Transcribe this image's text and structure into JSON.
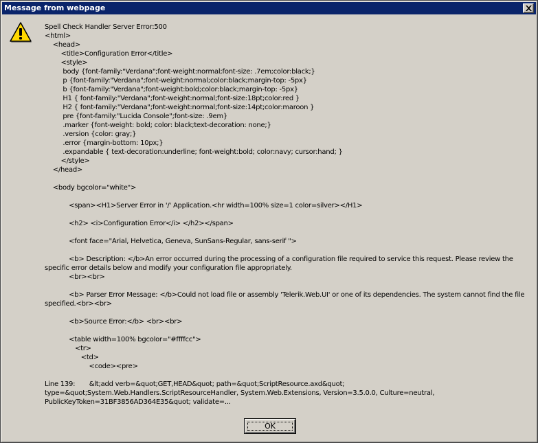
{
  "dialog": {
    "title": "Message from webpage",
    "icon": "warning-icon",
    "message": "Spell Check Handler Server Error:500\n<html>\n    <head>\n        <title>Configuration Error</title>\n        <style>\n         body {font-family:\"Verdana\";font-weight:normal;font-size: .7em;color:black;}\n         p {font-family:\"Verdana\";font-weight:normal;color:black;margin-top: -5px}\n         b {font-family:\"Verdana\";font-weight:bold;color:black;margin-top: -5px}\n         H1 { font-family:\"Verdana\";font-weight:normal;font-size:18pt;color:red }\n         H2 { font-family:\"Verdana\";font-weight:normal;font-size:14pt;color:maroon }\n         pre {font-family:\"Lucida Console\";font-size: .9em}\n         .marker {font-weight: bold; color: black;text-decoration: none;}\n         .version {color: gray;}\n         .error {margin-bottom: 10px;}\n         .expandable { text-decoration:underline; font-weight:bold; color:navy; cursor:hand; }\n        </style>\n    </head>\n\n    <body bgcolor=\"white\">\n\n            <span><H1>Server Error in '/' Application.<hr width=100% size=1 color=silver></H1>\n\n            <h2> <i>Configuration Error</i> </h2></span>\n\n            <font face=\"Arial, Helvetica, Geneva, SunSans-Regular, sans-serif \">\n\n            <b> Description: </b>An error occurred during the processing of a configuration file required to service this request. Please review the specific error details below and modify your configuration file appropriately.\n            <br><br>\n\n            <b> Parser Error Message: </b>Could not load file or assembly 'Telerik.Web.UI' or one of its dependencies. The system cannot find the file specified.<br><br>\n\n            <b>Source Error:</b> <br><br>\n\n            <table width=100% bgcolor=\"#ffffcc\">\n               <tr>\n                  <td>\n                      <code><pre>\n\nLine 139:       &lt;add verb=&quot;GET,HEAD&quot; path=&quot;ScriptResource.axd&quot; type=&quot;System.Web.Handlers.ScriptResourceHandler, System.Web.Extensions, Version=3.5.0.0, Culture=neutral, PublicKeyToken=31BF3856AD364E35&quot; validate=...",
    "ok_label": "OK"
  },
  "colors": {
    "titlebar": "#0a246a",
    "face": "#d4d0c8",
    "warning_fill": "#ffd800"
  }
}
